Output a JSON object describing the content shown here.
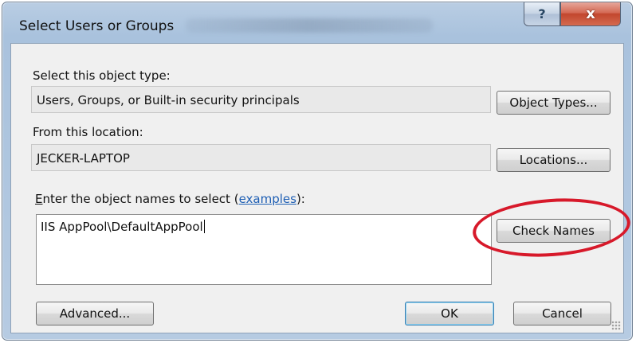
{
  "window": {
    "title": "Select Users or Groups",
    "help_glyph": "?",
    "close_glyph": "x"
  },
  "object_type": {
    "label": "Select this object type:",
    "value": "Users, Groups, or Built-in security principals",
    "button": "Object Types..."
  },
  "location": {
    "label": "From this location:",
    "value": "JECKER-LAPTOP",
    "button": "Locations..."
  },
  "names": {
    "label_mnemonic": "E",
    "label_prefix": "nter the object names to select (",
    "label_link": "examples",
    "label_suffix": "):",
    "value": "IIS AppPool\\DefaultAppPool",
    "check_button": "Check Names"
  },
  "footer": {
    "advanced_button": "Advanced...",
    "ok_button": "OK",
    "cancel_button": "Cancel"
  },
  "colors": {
    "annotation": "#d7192a",
    "link": "#1f5fb4"
  }
}
